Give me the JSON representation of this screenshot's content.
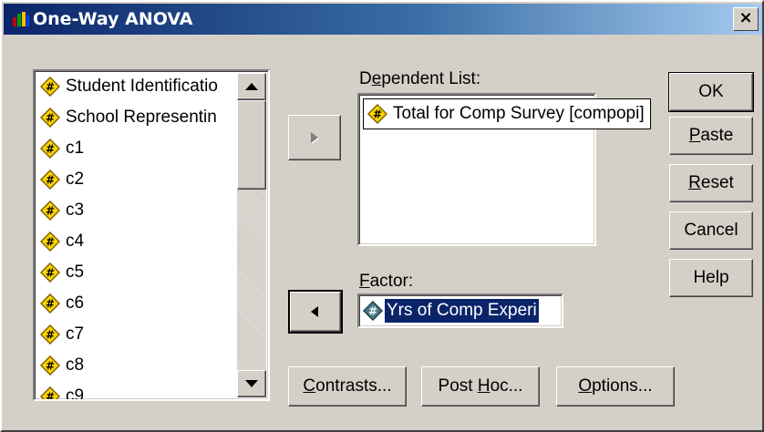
{
  "window": {
    "title": "One-Way ANOVA",
    "close_label": "×"
  },
  "variable_list": {
    "items": [
      {
        "label": "Student Identificatio"
      },
      {
        "label": "School Representin"
      },
      {
        "label": "c1"
      },
      {
        "label": "c2"
      },
      {
        "label": "c3"
      },
      {
        "label": "c4"
      },
      {
        "label": "c5"
      },
      {
        "label": "c6"
      },
      {
        "label": "c7"
      },
      {
        "label": "c8"
      },
      {
        "label": "c9"
      }
    ]
  },
  "dependent_list": {
    "label_pre": "D",
    "label_u": "e",
    "label_post": "pendent List:",
    "items": [
      {
        "label": "Total for Comp Survey [compopi]"
      }
    ]
  },
  "factor": {
    "label_u": "F",
    "label_post": "actor:",
    "value": "Yrs of Comp Experi"
  },
  "buttons": {
    "ok": "OK",
    "paste_u": "P",
    "paste_rest": "aste",
    "reset_u": "R",
    "reset_rest": "eset",
    "cancel": "Cancel",
    "help": "Help",
    "contrasts_u": "C",
    "contrasts_rest": "ontrasts...",
    "posthoc_pre": "Post ",
    "posthoc_u": "H",
    "posthoc_rest": "oc...",
    "options_u": "O",
    "options_rest": "ptions..."
  },
  "colors": {
    "face": "#d4d0c8",
    "selection": "#0a246a",
    "title_gradient_start": "#0a246a",
    "variable_icon_fill": "#ffd700"
  }
}
